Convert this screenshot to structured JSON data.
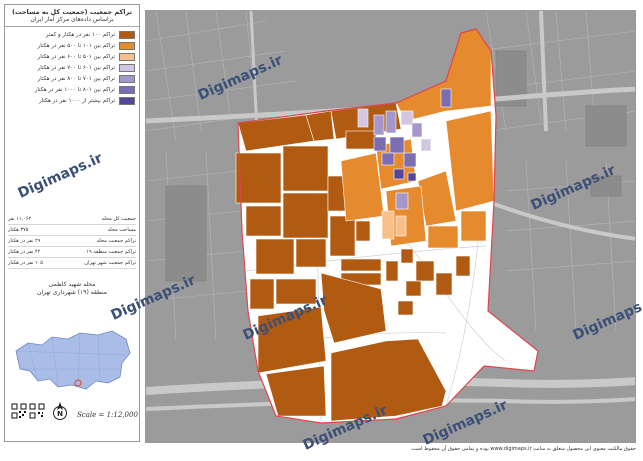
{
  "legend": {
    "title": "تراکم جمعیت (جمعیت کل به مساحت)",
    "subtitle": "براساس داده‌های مرکز آمار ایران",
    "items": [
      {
        "label": "تراکم ۱۰۰ نفر در هکتار و کمتر",
        "color": "#b05a12"
      },
      {
        "label": "تراکم بین ۱۰۱ تا ۵۰۰ نفر در هکتار",
        "color": "#e68a2e"
      },
      {
        "label": "تراکم بین ۵۰۱ تا ۶۰۰ نفر در هکتار",
        "color": "#f7c08a"
      },
      {
        "label": "تراکم بین ۶۰۱ تا ۷۰۰ نفر در هکتار",
        "color": "#d3c6e2"
      },
      {
        "label": "تراکم بین ۷۰۱ تا ۸۰۰ نفر در هکتار",
        "color": "#a597cb"
      },
      {
        "label": "تراکم بین ۸۰۱ تا ۱۰۰۰ نفر در هکتار",
        "color": "#7b6db4"
      },
      {
        "label": "تراکم بیشتر از ۱۰۰۰ نفر در هکتار",
        "color": "#52479a"
      }
    ]
  },
  "stats": [
    {
      "label": "جمعیت کل محله",
      "value": "۱۱,۰۶۲ نفر"
    },
    {
      "label": "مساحت محله",
      "value": "۳۷۵ هکتار"
    },
    {
      "label": "تراکم جمعیت محله",
      "value": "۲۹ نفر در هکتار"
    },
    {
      "label": "تراکم جمعیت منطقه ۱۹",
      "value": "۴۲ نفر در هکتار"
    },
    {
      "label": "تراکم جمعیت شهر تهران",
      "value": "۱۰۵ نفر در هکتار"
    }
  ],
  "locator": {
    "title_line1": "محله شهید کاظمی",
    "title_line2": "منطقه (۱۹) شهرداری تهران"
  },
  "scale": {
    "text": "Scale = 1:12,000"
  },
  "north_label": "N",
  "watermark_text": "Digimaps.ir",
  "footer": {
    "text": "حقوق مالکیت معنوی این محصول متعلق به سایت www.digimaps.ir بوده و تمامی حقوق آن محفوظ است."
  },
  "colors": {
    "road": "#c9c9c9",
    "background": "#9b9b9b",
    "boundary": "#e0454d",
    "river": "#bfbfbf"
  }
}
